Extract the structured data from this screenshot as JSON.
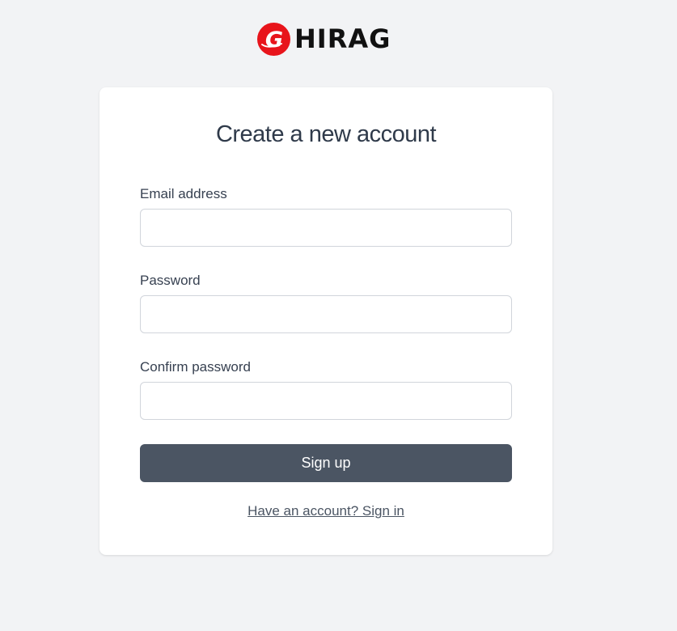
{
  "brand": {
    "name": "HIRAG",
    "mark_letter": "G",
    "mark_color": "#e8141b"
  },
  "form": {
    "title": "Create a new account",
    "email": {
      "label": "Email address",
      "value": "",
      "placeholder": ""
    },
    "password": {
      "label": "Password",
      "value": "",
      "placeholder": ""
    },
    "confirm_password": {
      "label": "Confirm password",
      "value": "",
      "placeholder": ""
    },
    "submit_label": "Sign up",
    "signin_link": "Have an account? Sign in"
  },
  "colors": {
    "background": "#f2f3f5",
    "card": "#ffffff",
    "button": "#4b5563",
    "text": "#374151"
  }
}
